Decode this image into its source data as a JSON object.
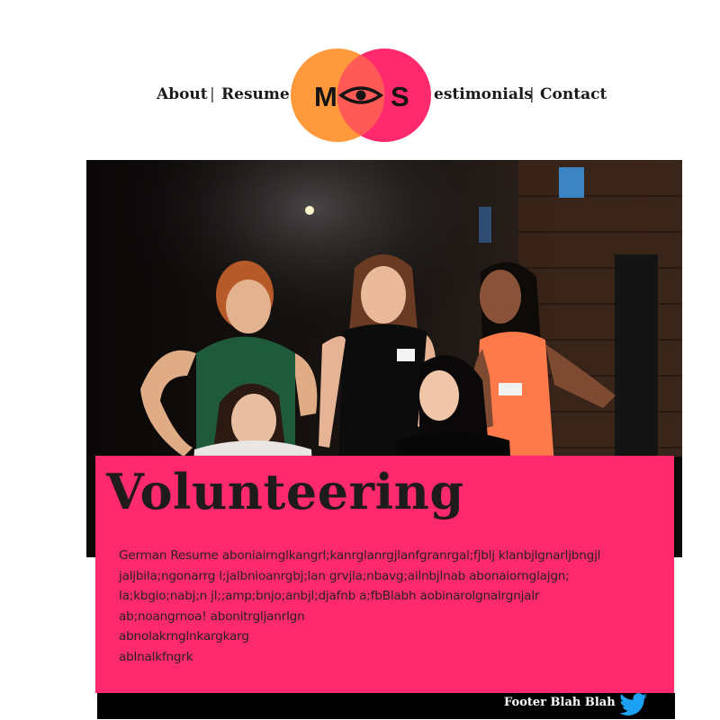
{
  "nav": {
    "items": [
      {
        "label": "About"
      },
      {
        "label": "Resume"
      },
      {
        "label": "estimonials"
      },
      {
        "label": "Contact"
      }
    ],
    "separator": "|"
  },
  "logo": {
    "left_letter": "M",
    "right_letter": "S",
    "icon": "eye-icon",
    "colors": {
      "left": "#ff9a3c",
      "right": "#ff2a6d",
      "overlap": "#ff5a55"
    }
  },
  "hero": {
    "image": "photo of five smiling women at an event"
  },
  "card": {
    "title": "Volunteering",
    "lines": [
      "German Resume aboniairnglkangrl;kanrglanrgjlanfgranrgal;fjblj klanbjlgnarljbngjl",
      "jaljbila;ngonarrg l;jalbnioanrgbj;lan grvjla;nbavg;ailnbjlnab abonaiornglajgn;",
      "la;kbgio;nabj;n jl;;amp;bnjo;anbjl;djafnb a;fbBlabh aobinarolgnalrgnjalr",
      "ab;noangrnoa! abonitrgljanrlgn",
      "abnolakrnglnkargkarg",
      "ablnalkfngrk"
    ],
    "color": "#ff2a6d"
  },
  "footer": {
    "text": "Footer Blah Blah",
    "icon": "twitter-icon",
    "icon_color": "#1da1f2"
  }
}
